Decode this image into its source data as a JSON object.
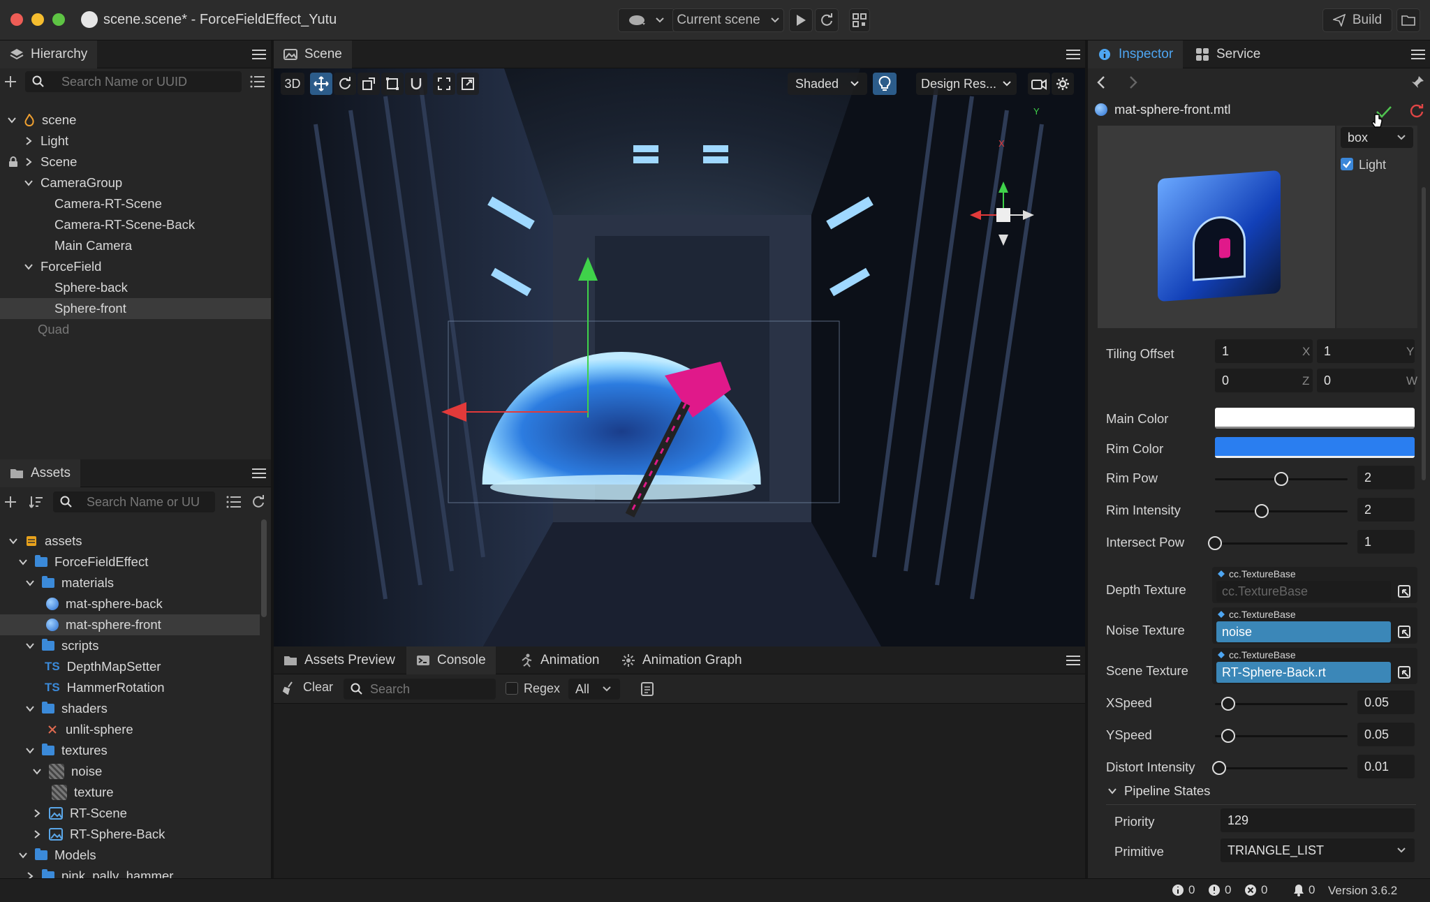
{
  "window": {
    "title": "scene.scene* - ForceFieldEffect_Yutu"
  },
  "toolbar": {
    "scene_select": "Current scene",
    "build_label": "Build"
  },
  "hierarchy": {
    "title": "Hierarchy",
    "search_placeholder": "Search Name or UUID",
    "nodes": [
      "scene",
      "Light",
      "Scene",
      "CameraGroup",
      "Camera-RT-Scene",
      "Camera-RT-Scene-Back",
      "Main Camera",
      "ForceField",
      "Sphere-back",
      "Sphere-front",
      "Quad"
    ]
  },
  "assets": {
    "title": "Assets",
    "search_placeholder": "Search Name or UU",
    "nodes": [
      "assets",
      "ForceFieldEffect",
      "materials",
      "mat-sphere-back",
      "mat-sphere-front",
      "scripts",
      "DepthMapSetter",
      "HammerRotation",
      "shaders",
      "unlit-sphere",
      "textures",
      "noise",
      "texture",
      "RT-Scene",
      "RT-Sphere-Back",
      "Models",
      "pink_pally_hammer"
    ],
    "ts_badge": "TS"
  },
  "scene_panel": {
    "title": "Scene",
    "mode_3d": "3D",
    "shading": "Shaded",
    "resolution": "Design Res...",
    "axis_x": "X",
    "axis_y": "Y"
  },
  "console": {
    "tabs": [
      "Assets Preview",
      "Console",
      "Animation",
      "Animation Graph"
    ],
    "clear_label": "Clear",
    "search_placeholder": "Search",
    "regex_label": "Regex",
    "filter": "All"
  },
  "inspector": {
    "tabs": [
      "Inspector",
      "Service"
    ],
    "asset_name": "mat-sphere-front.mtl",
    "preview_shape": "box",
    "preview_light_label": "Light",
    "tiling_offset": {
      "label": "Tiling Offset",
      "x": "1",
      "y": "1",
      "z": "0",
      "w": "0",
      "lx": "X",
      "ly": "Y",
      "lz": "Z",
      "lw": "W"
    },
    "main_color": {
      "label": "Main Color",
      "value": "#ffffff"
    },
    "rim_color": {
      "label": "Rim Color",
      "value": "#2a7ef0"
    },
    "sliders": [
      {
        "label": "Rim Pow",
        "value": "2",
        "fraction": 0.5
      },
      {
        "label": "Rim Intensity",
        "value": "2",
        "fraction": 0.35
      },
      {
        "label": "Intersect Pow",
        "value": "1",
        "fraction": 0.0
      }
    ],
    "textures": [
      {
        "label": "Depth Texture",
        "type": "cc.TextureBase",
        "value": "cc.TextureBase",
        "assigned": false
      },
      {
        "label": "Noise Texture",
        "type": "cc.TextureBase",
        "value": "noise",
        "assigned": true
      },
      {
        "label": "Scene Texture",
        "type": "cc.TextureBase",
        "value": "RT-Sphere-Back.rt",
        "assigned": true
      }
    ],
    "speed_sliders": [
      {
        "label": "XSpeed",
        "value": "0.05",
        "fraction": 0.1
      },
      {
        "label": "YSpeed",
        "value": "0.05",
        "fraction": 0.1
      },
      {
        "label": "Distort Intensity",
        "value": "0.01",
        "fraction": 0.03
      }
    ],
    "pipeline": {
      "title": "Pipeline States",
      "priority_label": "Priority",
      "priority": "129",
      "primitive_label": "Primitive",
      "primitive": "TRIANGLE_LIST"
    }
  },
  "status": {
    "info": "0",
    "warn": "0",
    "error": "0",
    "notify": "0",
    "version": "Version 3.6.2"
  },
  "colors": {
    "accent": "#3b8ad9",
    "selected_field": "#3b87b8"
  }
}
